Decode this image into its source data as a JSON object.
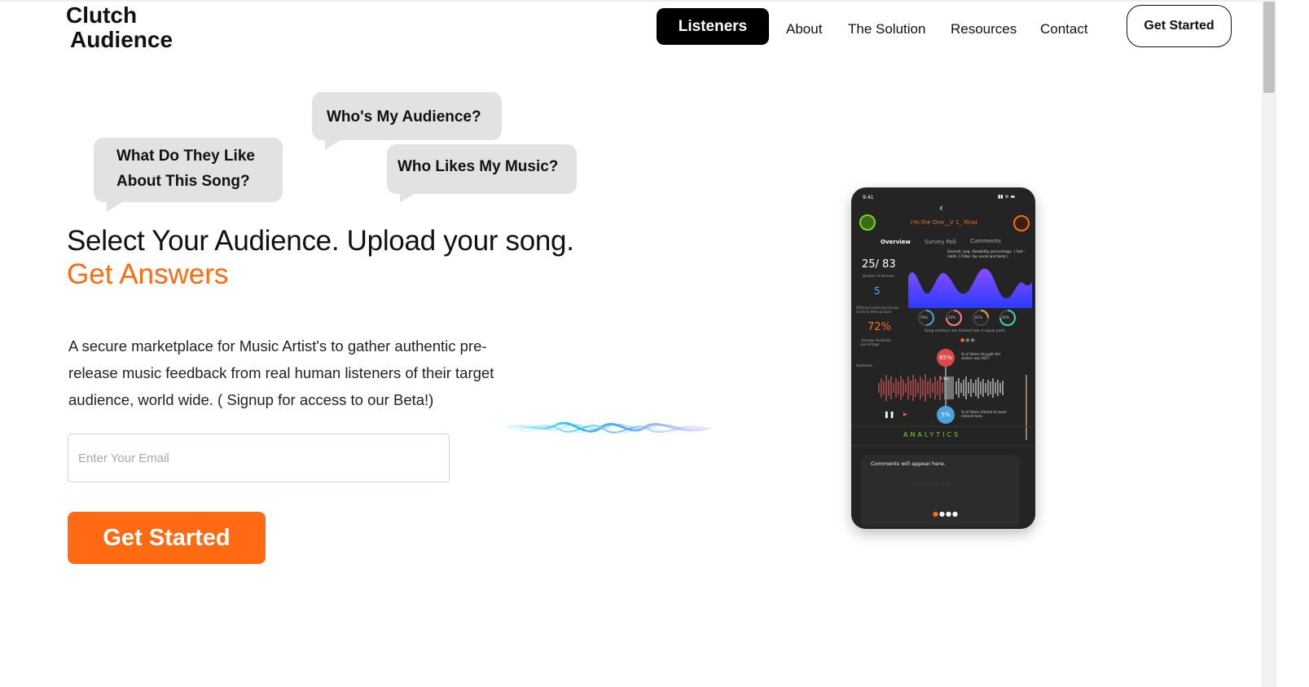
{
  "header": {
    "logo_line1": "Clutch",
    "logo_line2": "Audience",
    "nav": {
      "active": "Listeners",
      "links": [
        "About",
        "The Solution",
        "Resources",
        "Contact"
      ]
    },
    "cta_label": "Get Started"
  },
  "bubbles": {
    "like_line1": "What Do They Like",
    "like_line2": "About This Song?",
    "audience": "Who's My Audience?",
    "music": "Who Likes My Music?"
  },
  "hero": {
    "headline": "Select Your Audience. Upload your song.",
    "accent": "Get Answers",
    "description_line1": "A secure marketplace for Music Artist's to gather authentic pre-",
    "description_line2": "release music feedback from real human listeners of their target",
    "description_line3": "audience, world wide. ( Signup for access to our Beta!)",
    "email_placeholder": "Enter Your Email",
    "cta_label": "Get Started"
  },
  "phone": {
    "time": "9:41",
    "song_title": "I'm the One__V 1_ Final",
    "tabs": [
      "Overview",
      "Survey Poll",
      "Comments"
    ],
    "reviews": "25/ 83",
    "reviews_label": "Number of Reviews",
    "groups": "5",
    "groups_label": "Different Listening Groups (Click to filter groups)",
    "avg": "72%",
    "avg_label": "Average likeability percentage",
    "chart_note": "Overall, avg. likeability percentage. ( Hot - cold). ( Filter: by vocal and beat )",
    "rings": [
      "50%",
      "50%",
      "61%",
      "50%"
    ],
    "sections_note": "Song sections are divided into 4 equal parts",
    "sections_label": "Sections:",
    "hot_pct": "65%",
    "hot_note": "% of Voters thought this section was HOT!",
    "marker": "5 Sec",
    "cold_pct": "5%",
    "cold_note": "% of Voters started to loose interest here.",
    "analytics": "ANALYTICS",
    "comments_text": "Comments will appear here.",
    "comments_box": "Comments Box"
  },
  "colors": {
    "accent": "#ff6a13",
    "dark": "#000000",
    "bubble": "#e2e2e2",
    "phone_bg": "#242424",
    "hot": "#e04848",
    "cold": "#4aa3df",
    "green": "#7ad321"
  }
}
